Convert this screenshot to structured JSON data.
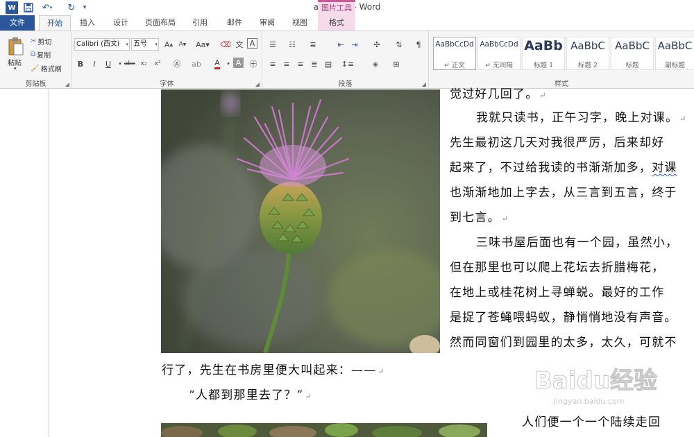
{
  "window": {
    "doc_title": "abc.docx - Word",
    "context_group_label": "图片工具"
  },
  "quick_access": {
    "icons": [
      "word-logo-icon",
      "save-icon",
      "undo-icon",
      "redo-icon",
      "customize-icon"
    ]
  },
  "tabs": [
    {
      "label": "文件"
    },
    {
      "label": "开始"
    },
    {
      "label": "插入"
    },
    {
      "label": "设计"
    },
    {
      "label": "页面布局"
    },
    {
      "label": "引用"
    },
    {
      "label": "邮件"
    },
    {
      "label": "审阅"
    },
    {
      "label": "视图"
    },
    {
      "label": "格式"
    }
  ],
  "ribbon": {
    "clipboard": {
      "paste_label": "粘贴",
      "cut_label": "剪切",
      "copy_label": "复制",
      "format_painter_label": "格式刷",
      "group_label": "剪贴板"
    },
    "font": {
      "font_name": "Calibri (西文i",
      "font_size": "五号",
      "group_label": "字体"
    },
    "paragraph": {
      "group_label": "段落"
    },
    "styles": {
      "group_label": "样式",
      "items": [
        {
          "sample": "AaBbCcDd",
          "name": "↵ 正文"
        },
        {
          "sample": "AaBbCcDd",
          "name": "↵ 无间隔"
        },
        {
          "sample": "AaBb",
          "name": "标题 1"
        },
        {
          "sample": "AaBbC",
          "name": "标题 2"
        },
        {
          "sample": "AaBbC",
          "name": "标题"
        },
        {
          "sample": "AaBbC",
          "name": "副标题"
        }
      ]
    }
  },
  "document": {
    "lines_right": [
      "我就只读书，正午习字，晚上对课。",
      "先生最初这几天对我很严厉，后来却好",
      "起来了，不过给我读的书渐渐加多，",
      "也渐渐地加上字去，从三言到五言，终于",
      "到七言。",
      "三味书屋后面也有一个园，虽然小，",
      "但在那里也可以爬上花坛去折腊梅花，",
      "在地上或桂花树上寻蝉蜕。最好的工作",
      "是捉了苍蝇喂蚂蚁，静悄悄地没有声音。",
      "然而同窗们到园里的太多，太久，可就不"
    ],
    "top_partial": "觉过好几回了。",
    "duike": "对课",
    "line_full": "行了，先生在书房里便大叫起来：——",
    "quote": "“人都到那里去了？”",
    "bottom_right": "人们便一个一个陆续走回"
  },
  "watermark": {
    "text": "Baidu经验",
    "sub": "jingyan.baidu.com"
  }
}
